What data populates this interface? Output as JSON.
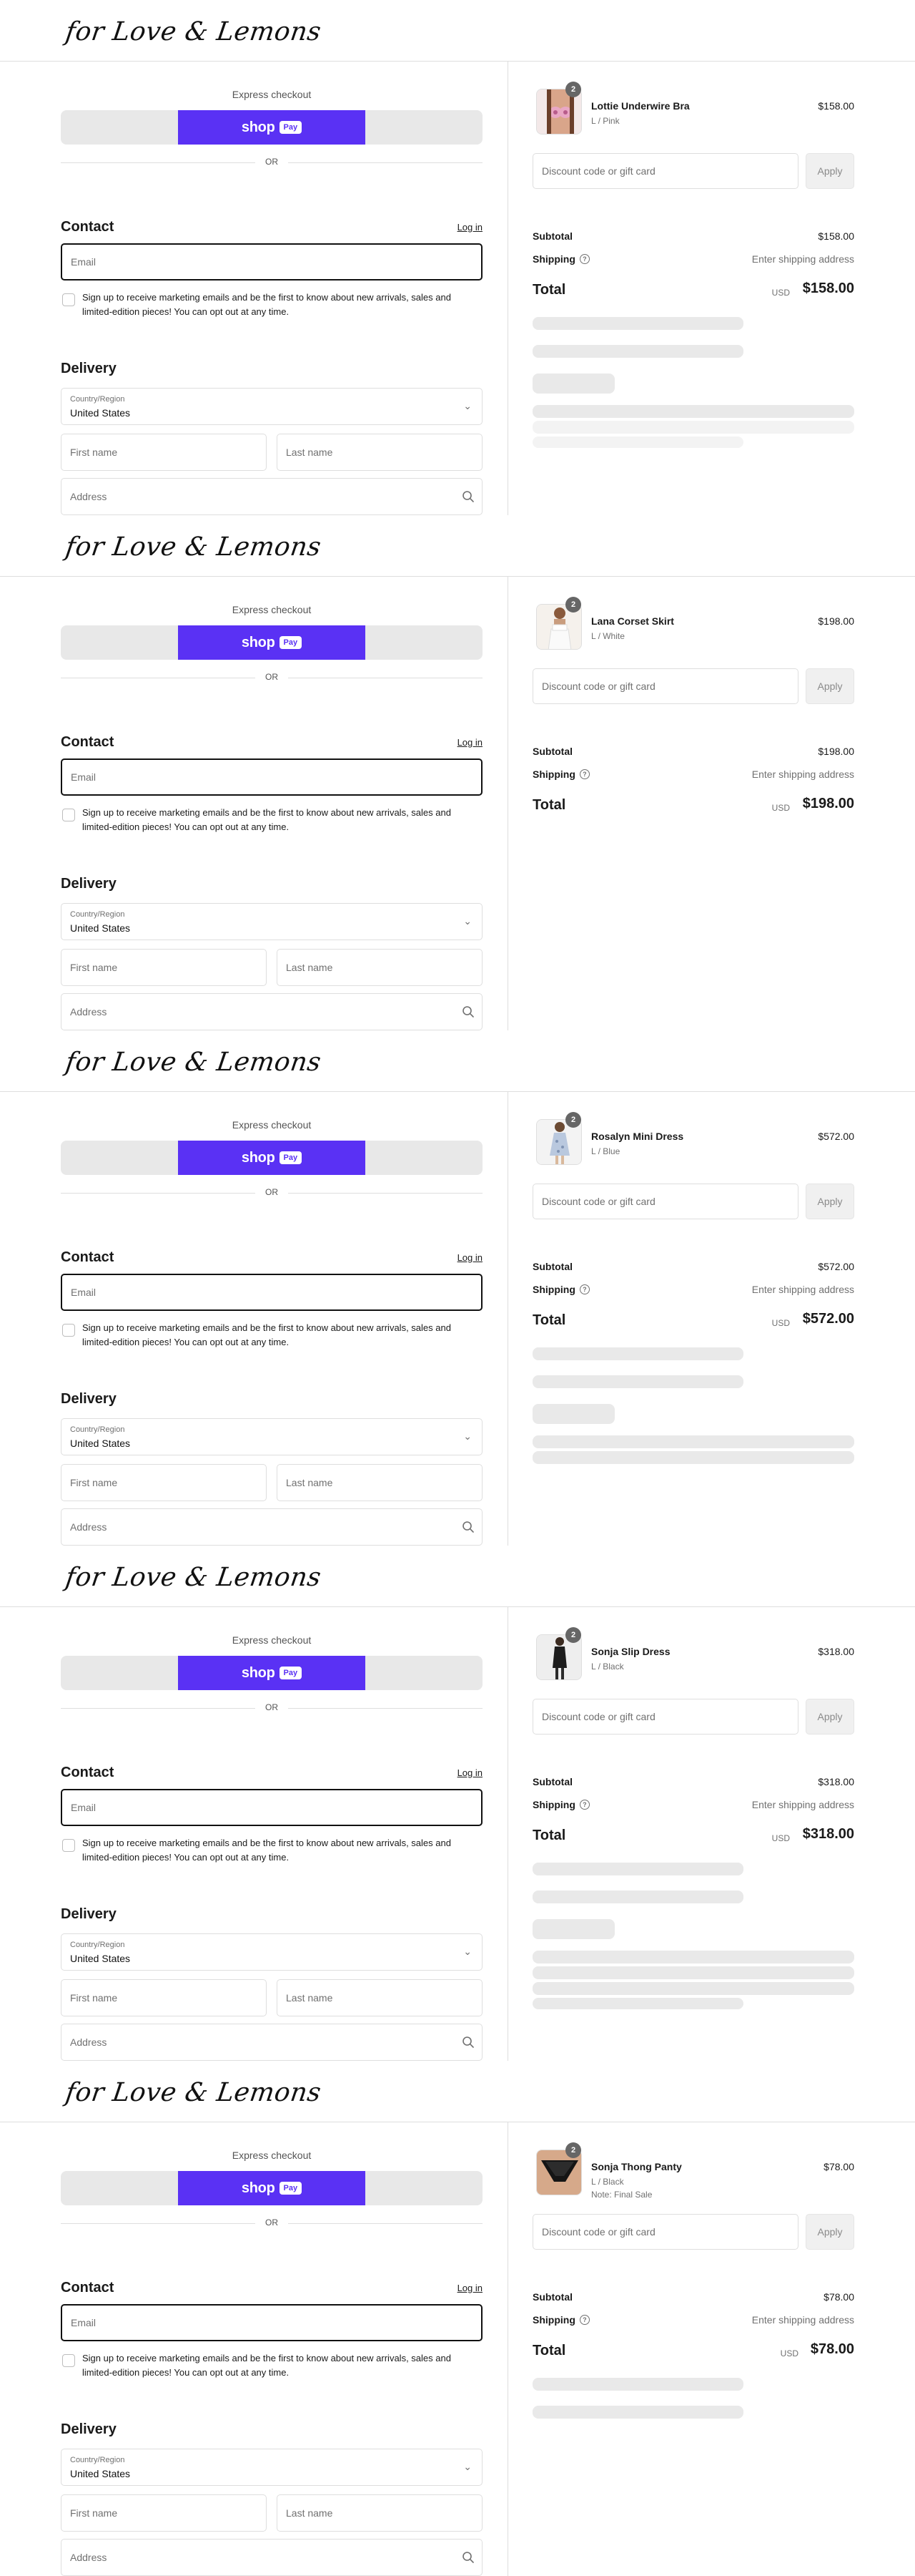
{
  "brand": {
    "logo_text": "for Love & Lemons"
  },
  "common": {
    "express_label": "Express checkout",
    "shop_word": "shop",
    "pay_chip": "Pay",
    "or_text": "OR",
    "contact_heading": "Contact",
    "login_link": "Log in",
    "email_placeholder": "Email",
    "marketing_opt_in": "Sign up to receive marketing emails and be the first to know about new arrivals, sales and limited-edition pieces! You can opt out at any time.",
    "delivery_heading": "Delivery",
    "country_caption": "Country/Region",
    "country_value": "United States",
    "first_name_placeholder": "First name",
    "last_name_placeholder": "Last name",
    "address_placeholder": "Address",
    "discount_placeholder": "Discount code or gift card",
    "apply_label": "Apply",
    "subtotal_label": "Subtotal",
    "shipping_label": "Shipping",
    "shipping_value": "Enter shipping address",
    "total_label": "Total",
    "currency": "USD",
    "icons": {
      "chevron": "chevron-down-icon",
      "search": "search-icon",
      "help": "question-circle-icon"
    },
    "colors": {
      "shop_pay": "#5a31f4",
      "express_bg": "#e8e8e8",
      "border": "#dedede"
    }
  },
  "sections": [
    {
      "product_name": "Lottie Underwire Bra",
      "variant": "L / Pink",
      "note": "",
      "quantity": "2",
      "price": "$158.00",
      "subtotal": "$158.00",
      "total": "$158.00",
      "image_theme": "pink-bra"
    },
    {
      "product_name": "Lana Corset Skirt",
      "variant": "L / White",
      "note": "",
      "quantity": "2",
      "price": "$198.00",
      "subtotal": "$198.00",
      "total": "$198.00",
      "image_theme": "white-skirt"
    },
    {
      "product_name": "Rosalyn Mini Dress",
      "variant": "L / Blue",
      "note": "",
      "quantity": "2",
      "price": "$572.00",
      "subtotal": "$572.00",
      "total": "$572.00",
      "image_theme": "blue-dress"
    },
    {
      "product_name": "Sonja Slip Dress",
      "variant": "L / Black",
      "note": "",
      "quantity": "2",
      "price": "$318.00",
      "subtotal": "$318.00",
      "total": "$318.00",
      "image_theme": "black-slip"
    },
    {
      "product_name": "Sonja Thong Panty",
      "variant": "L / Black",
      "note": "Note: Final Sale",
      "quantity": "2",
      "price": "$78.00",
      "subtotal": "$78.00",
      "total": "$78.00",
      "image_theme": "black-thong"
    }
  ]
}
